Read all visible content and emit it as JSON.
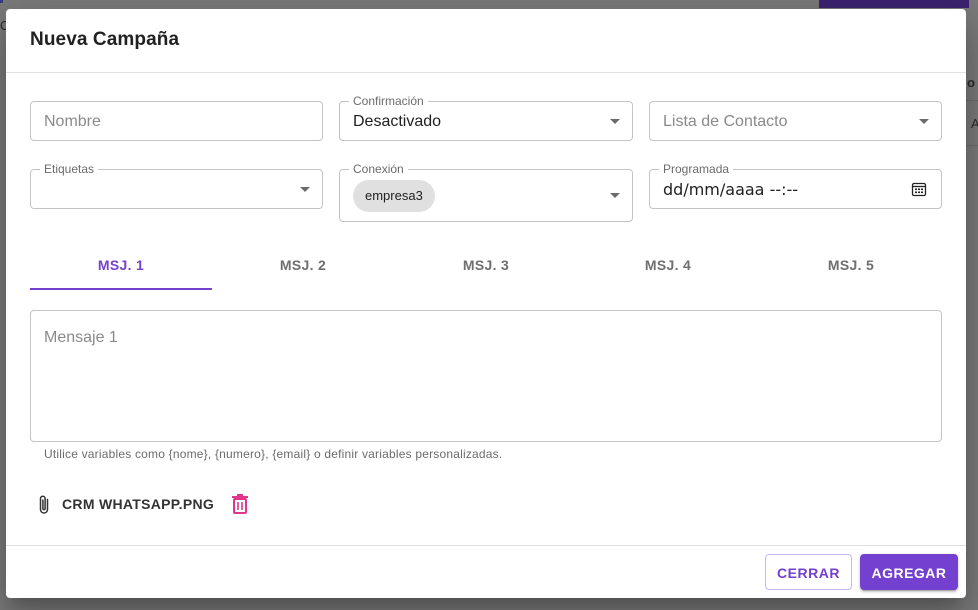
{
  "background": {
    "fragment_left": "C",
    "fragment_right_1": "o",
    "fragment_right_2": "A"
  },
  "dialog": {
    "title": "Nueva Campaña"
  },
  "form": {
    "nombre": {
      "placeholder": "Nombre"
    },
    "confirmacion": {
      "label": "Confirmación",
      "value": "Desactivado"
    },
    "lista_contacto": {
      "placeholder": "Lista de Contacto"
    },
    "etiquetas": {
      "label": "Etiquetas",
      "value": ""
    },
    "conexion": {
      "label": "Conexión",
      "chip": "empresa3"
    },
    "programada": {
      "label": "Programada",
      "value": "dd/mm/aaaa --:--"
    }
  },
  "tabs": [
    {
      "label": "MSJ. 1",
      "active": true
    },
    {
      "label": "MSJ. 2",
      "active": false
    },
    {
      "label": "MSJ. 3",
      "active": false
    },
    {
      "label": "MSJ. 4",
      "active": false
    },
    {
      "label": "MSJ. 5",
      "active": false
    }
  ],
  "message": {
    "placeholder": "Mensaje 1",
    "helper": "Utilice variables como {nome}, {numero}, {email} o definir variables personalizadas."
  },
  "attachment": {
    "filename": "CRM WHATSAPP.PNG",
    "icon": "paperclip-icon",
    "delete_icon": "trash-icon"
  },
  "actions": {
    "cancel_label": "CERRAR",
    "submit_label": "AGREGAR"
  },
  "colors": {
    "accent": "#7340cf",
    "delete": "#e0368c"
  }
}
